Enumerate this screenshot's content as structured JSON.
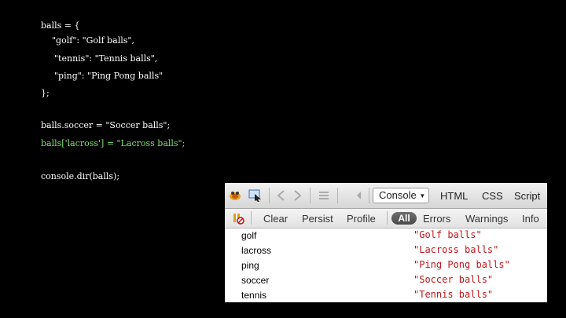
{
  "code": {
    "lines": [
      "balls = {",
      "\"golf\": \"Golf balls\",",
      "\"tennis\": \"Tennis balls\",",
      "\"ping\": \"Ping Pong balls\"",
      "};",
      "balls.soccer = \"Soccer balls\";",
      "balls['lacross'] = \"Lacross balls\";",
      "console.dir(balls);"
    ],
    "highlight_color": "#7de36a"
  },
  "firebug": {
    "tabs": {
      "console": "Console",
      "html": "HTML",
      "css": "CSS",
      "script": "Script"
    },
    "filters": {
      "clear": "Clear",
      "persist": "Persist",
      "profile": "Profile",
      "all": "All",
      "errors": "Errors",
      "warnings": "Warnings",
      "info": "Info"
    },
    "rows": [
      {
        "key": "golf",
        "value": "\"Golf balls\""
      },
      {
        "key": "lacross",
        "value": "\"Lacross balls\""
      },
      {
        "key": "ping",
        "value": "\"Ping Pong balls\""
      },
      {
        "key": "soccer",
        "value": "\"Soccer balls\""
      },
      {
        "key": "tennis",
        "value": "\"Tennis balls\""
      }
    ],
    "value_color": "#c0161b",
    "icons": [
      "firebug-icon",
      "inspect-icon",
      "back-icon",
      "forward-icon",
      "list-icon",
      "chevron-down-icon",
      "pause-icon"
    ]
  }
}
